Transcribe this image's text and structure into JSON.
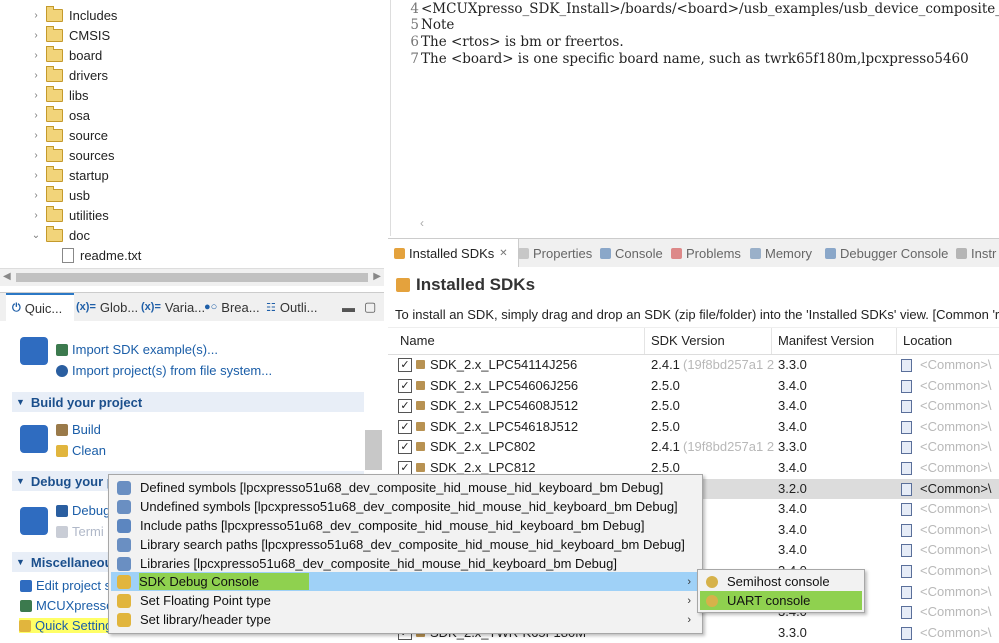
{
  "project_tree": {
    "items": [
      {
        "label": "Includes",
        "type": "folder"
      },
      {
        "label": "CMSIS",
        "type": "folder"
      },
      {
        "label": "board",
        "type": "folder"
      },
      {
        "label": "drivers",
        "type": "folder"
      },
      {
        "label": "libs",
        "type": "folder"
      },
      {
        "label": "osa",
        "type": "folder"
      },
      {
        "label": "source",
        "type": "folder"
      },
      {
        "label": "sources",
        "type": "folder"
      },
      {
        "label": "startup",
        "type": "folder"
      },
      {
        "label": "usb",
        "type": "folder"
      },
      {
        "label": "utilities",
        "type": "folder"
      },
      {
        "label": "doc",
        "type": "folder-open"
      },
      {
        "label": "readme.txt",
        "type": "file"
      }
    ]
  },
  "editor": {
    "lines": [
      {
        "number": "4",
        "text": "<MCUXpresso_SDK_Install>/boards/<board>/usb_examples/usb_device_composite_"
      },
      {
        "number": "5",
        "text": "Note"
      },
      {
        "number": "6",
        "text": "The <rtos> is bm or freertos."
      },
      {
        "number": "7",
        "text": "The <board> is one specific board name, such as twrk65f180m,lpcxpresso5460"
      }
    ]
  },
  "quickstart": {
    "tabs": [
      {
        "label": "Quic...",
        "icon": "quickstart-icon"
      },
      {
        "label": "Glob...",
        "icon": "variable-icon"
      },
      {
        "label": "Varia...",
        "icon": "variable-icon"
      },
      {
        "label": "Brea...",
        "icon": "breakpoint-icon"
      },
      {
        "label": "Outli...",
        "icon": "outline-icon"
      }
    ],
    "import_links": [
      "Import SDK example(s)...",
      "Import project(s) from file system..."
    ],
    "build_section": "Build your project",
    "build_links": [
      "Build",
      "Clean"
    ],
    "debug_section": "Debug your p",
    "debug_links": [
      "Debug",
      "Termi"
    ],
    "misc_section": "Miscellaneou",
    "misc_links": [
      "Edit project s",
      "MCUXpresso",
      "Quick Settings"
    ]
  },
  "sdk_view": {
    "tabs": [
      "Installed SDKs",
      "Properties",
      "Console",
      "Problems",
      "Memory",
      "Debugger Console",
      "Instr"
    ],
    "close_glyph": "✕",
    "title": "Installed SDKs",
    "hint": "To install an SDK, simply drag and drop an SDK (zip file/folder) into the 'Installed SDKs' view. [Common 'r",
    "columns": [
      "Name",
      "SDK Version",
      "Manifest Version",
      "Location"
    ],
    "rows": [
      {
        "name": "SDK_2.x_LPC54114J256",
        "version": "2.4.1",
        "hash": "(19f8bd257a1 2",
        "manifest": "3.3.0",
        "location": "<Common>\\"
      },
      {
        "name": "SDK_2.x_LPC54606J256",
        "version": "2.5.0",
        "hash": "",
        "manifest": "3.4.0",
        "location": "<Common>\\"
      },
      {
        "name": "SDK_2.x_LPC54608J512",
        "version": "2.5.0",
        "hash": "",
        "manifest": "3.4.0",
        "location": "<Common>\\"
      },
      {
        "name": "SDK_2.x_LPC54618J512",
        "version": "2.5.0",
        "hash": "",
        "manifest": "3.4.0",
        "location": "<Common>\\"
      },
      {
        "name": "SDK_2.x_LPC802",
        "version": "2.4.1",
        "hash": "(19f8bd257a1 2",
        "manifest": "3.3.0",
        "location": "<Common>\\"
      },
      {
        "name": "SDK_2.x_LPC812",
        "version": "2.5.0",
        "hash": "",
        "manifest": "3.4.0",
        "location": "<Common>\\"
      },
      {
        "name": "",
        "version": "",
        "hash": "",
        "manifest": "3.2.0",
        "location": "<Common>\\"
      },
      {
        "name": "",
        "version": "",
        "hash": "",
        "manifest": "3.4.0",
        "location": "<Common>\\"
      },
      {
        "name": "",
        "version": "",
        "hash": "",
        "manifest": "3.4.0",
        "location": "<Common>\\"
      },
      {
        "name": "",
        "version": "",
        "hash": "",
        "manifest": "3.4.0",
        "location": "<Common>\\"
      },
      {
        "name": "",
        "version": "",
        "hash": "",
        "manifest": "3.4.0",
        "location": "<Common>\\"
      },
      {
        "name": "",
        "version": "",
        "hash": "",
        "manifest": "3.4.0",
        "location": "<Common>\\"
      },
      {
        "name": "",
        "version": "",
        "hash": "",
        "manifest": "3.4.0",
        "location": "<Common>\\"
      },
      {
        "name": "SDK_2.x_TWR-K65F180M",
        "version": "",
        "hash": "",
        "manifest": "3.3.0",
        "location": "<Common>\\"
      }
    ]
  },
  "context_menu": {
    "items": [
      {
        "label": "Defined symbols [lpcxpresso51u68_dev_composite_hid_mouse_hid_keyboard_bm Debug]",
        "has_submenu": false
      },
      {
        "label": "Undefined symbols [lpcxpresso51u68_dev_composite_hid_mouse_hid_keyboard_bm Debug]",
        "has_submenu": false
      },
      {
        "label": "Include paths [lpcxpresso51u68_dev_composite_hid_mouse_hid_keyboard_bm Debug]",
        "has_submenu": false
      },
      {
        "label": "Library search paths [lpcxpresso51u68_dev_composite_hid_mouse_hid_keyboard_bm Debug]",
        "has_submenu": false
      },
      {
        "label": "Libraries [lpcxpresso51u68_dev_composite_hid_mouse_hid_keyboard_bm Debug]",
        "has_submenu": false
      },
      {
        "label": "SDK Debug Console",
        "has_submenu": true
      },
      {
        "label": "Set Floating Point type",
        "has_submenu": true
      },
      {
        "label": "Set library/header type",
        "has_submenu": true
      }
    ],
    "arrow_glyph": "›",
    "submenu": [
      "Semihost console",
      "UART console"
    ]
  },
  "colors": {
    "highlight_blue": "#9fd1f7",
    "highlight_green": "#8fd14f",
    "link_blue": "#1b5ea8"
  }
}
